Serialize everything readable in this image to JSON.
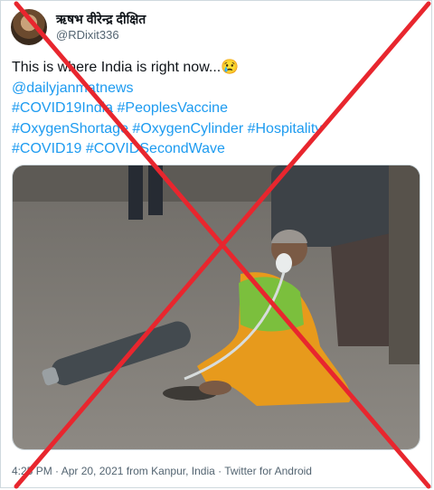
{
  "author": {
    "display_name": "ऋषभ वीरेन्द्र दीक्षित",
    "handle": "@RDixit336"
  },
  "tweet": {
    "lines": [
      "This is where India is right now...😢",
      "@dailyjanmatnews",
      "#COVID19India #PeoplesVaccine",
      "#OxygenShortage #OxygenCylinder #Hospitality",
      "#COVID19 #COVIDSecondWave"
    ]
  },
  "footer": {
    "metadata": "4:25 PM · Apr 20, 2021 from Kanpur, India · Twitter for Android"
  },
  "colors": {
    "link": "#1d9bf0",
    "cross": "#e8262e",
    "text": "#0f1419",
    "secondary": "#536471"
  }
}
